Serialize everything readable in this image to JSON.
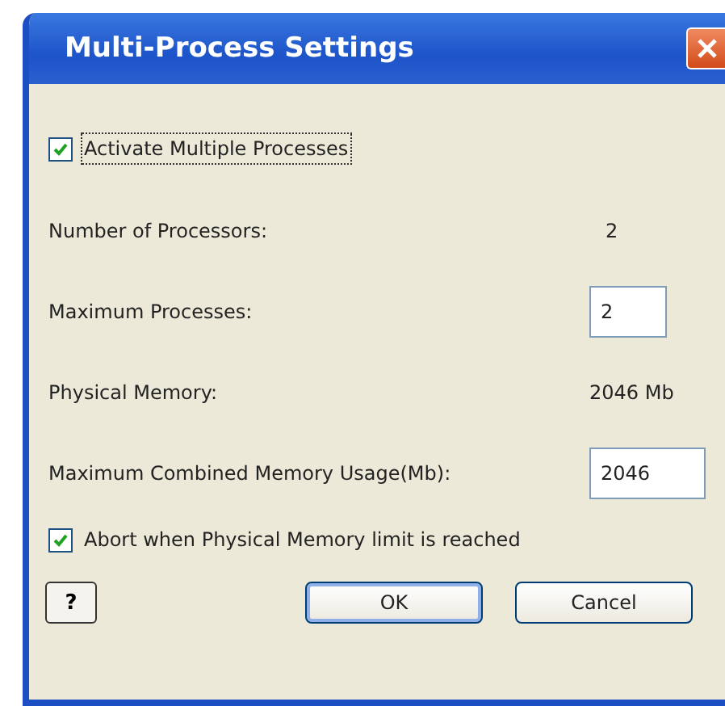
{
  "window": {
    "title": "Multi-Process Settings"
  },
  "activate": {
    "label": "Activate Multiple Processes",
    "checked": true
  },
  "rows": [
    {
      "kind": "value",
      "label": "Number of Processors:",
      "value": "2"
    },
    {
      "kind": "field",
      "label": "Maximum Processes:",
      "value": "2"
    },
    {
      "kind": "value",
      "label": "Physical Memory:",
      "value": "2046 Mb"
    },
    {
      "kind": "field",
      "label": "Maximum Combined Memory Usage(Mb):",
      "value": "2046"
    }
  ],
  "abort": {
    "label": "Abort when Physical Memory limit is reached",
    "checked": true
  },
  "help": {
    "label": "?"
  },
  "buttons": [
    {
      "label": "OK",
      "default": true
    },
    {
      "label": "Cancel",
      "default": false
    }
  ]
}
